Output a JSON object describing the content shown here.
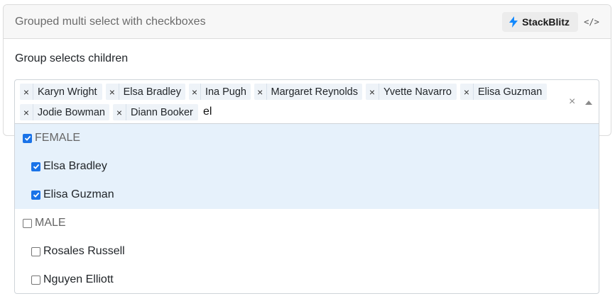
{
  "card": {
    "title": "Grouped multi select with checkboxes",
    "stackblitz_label": "StackBlitz",
    "code_icon": "code-icon",
    "bolt_icon": "lightning-bolt-icon",
    "bolt_color": "#1389fd"
  },
  "section_label": "Group selects children",
  "select": {
    "tags": [
      "Karyn Wright",
      "Elsa Bradley",
      "Ina Pugh",
      "Margaret Reynolds",
      "Yvette Navarro",
      "Elisa Guzman",
      "Jodie Bowman",
      "Diann Booker"
    ],
    "search_value": "el",
    "clear_icon": "×",
    "tag_remove_icon": "×"
  },
  "dropdown": {
    "options": [
      {
        "label": "FEMALE",
        "type": "group",
        "checked": true,
        "selected": true
      },
      {
        "label": "Elsa Bradley",
        "type": "child",
        "checked": true,
        "selected": true
      },
      {
        "label": "Elisa Guzman",
        "type": "child",
        "checked": true,
        "selected": true
      },
      {
        "label": "MALE",
        "type": "group",
        "checked": false,
        "selected": false
      },
      {
        "label": "Rosales Russell",
        "type": "child",
        "checked": false,
        "selected": false
      },
      {
        "label": "Nguyen Elliott",
        "type": "child",
        "checked": false,
        "selected": false
      }
    ]
  },
  "colors": {
    "selected_bg": "#e6f1fb",
    "tag_bg": "#eef3f8",
    "checkbox_checked": "#1a73e8"
  }
}
